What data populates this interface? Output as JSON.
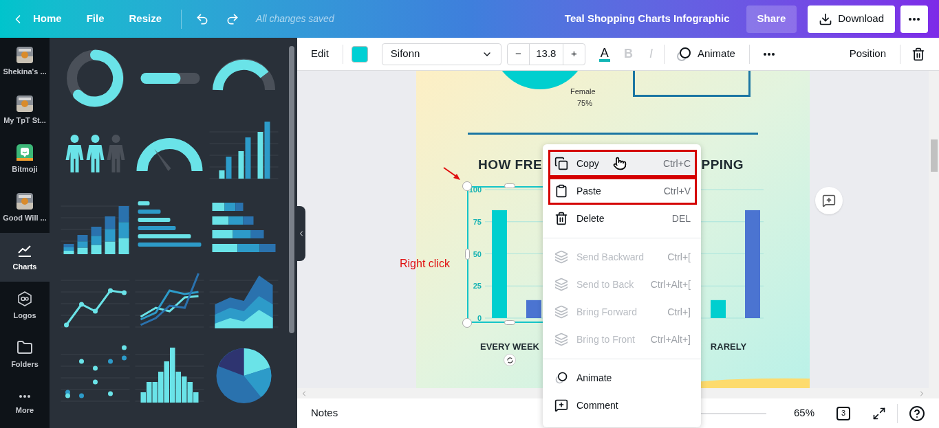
{
  "top_bar": {
    "home": "Home",
    "menu": [
      "File",
      "Resize"
    ],
    "save_status": "All changes saved",
    "title": "Teal Shopping Charts Infographic",
    "share": "Share",
    "download": "Download"
  },
  "rail": [
    {
      "label": "Shekina's ...",
      "kind": "picture",
      "selected": false
    },
    {
      "label": "My TpT St...",
      "kind": "picture",
      "selected": false
    },
    {
      "label": "Bitmoji",
      "kind": "bitmoji",
      "selected": false
    },
    {
      "label": "Good Will ...",
      "kind": "picture",
      "selected": false
    },
    {
      "label": "Charts",
      "kind": "charts",
      "selected": true
    },
    {
      "label": "Logos",
      "kind": "logos",
      "selected": false
    },
    {
      "label": "Folders",
      "kind": "folders",
      "selected": false
    },
    {
      "label": "More",
      "kind": "more",
      "selected": false
    }
  ],
  "panel": {
    "thumbnails": [
      {
        "kind": "donut"
      },
      {
        "kind": "progress"
      },
      {
        "kind": "half_donut"
      },
      {
        "kind": "people"
      },
      {
        "kind": "gauge"
      },
      {
        "kind": "grouped_bars"
      },
      {
        "kind": "stacked_bars"
      },
      {
        "kind": "horizontal_bars"
      },
      {
        "kind": "stacked_horizontal"
      },
      {
        "kind": "line"
      },
      {
        "kind": "multi_line"
      },
      {
        "kind": "area"
      },
      {
        "kind": "dot_plot"
      },
      {
        "kind": "histogram"
      },
      {
        "kind": "pie"
      }
    ]
  },
  "toolbar": {
    "edit": "Edit",
    "color": "#00d0d4",
    "font": "Sifonn",
    "decrease": "−",
    "font_size": "13.8",
    "increase": "+",
    "text_color": "A",
    "bold": {
      "label": "B",
      "disabled": true
    },
    "italic": {
      "label": "I",
      "disabled": true
    },
    "animate": "Animate",
    "position": "Position"
  },
  "page": {
    "female_label": "Female",
    "female_value": "75%",
    "heading_left": "HOW FRE",
    "heading_right": "PPING",
    "chart_data": {
      "type": "bar",
      "categories": [
        "EVERY WEEK",
        "RARELY"
      ],
      "series": [
        {
          "color": "#00cfcf",
          "values": [
            84,
            14
          ]
        },
        {
          "color": "#4b74d1",
          "values": [
            14,
            84
          ]
        }
      ],
      "ylim": [
        0,
        100
      ],
      "yticks": [
        0,
        25,
        50,
        75,
        100
      ],
      "grid": true
    }
  },
  "annotation": {
    "text": "Right click"
  },
  "context_menu": {
    "groups": [
      [
        {
          "label": "Copy",
          "shortcut": "Ctrl+C",
          "disabled": false,
          "selected": true,
          "highlighted": true
        },
        {
          "label": "Paste",
          "shortcut": "Ctrl+V",
          "disabled": false,
          "selected": false,
          "highlighted": true
        },
        {
          "label": "Delete",
          "shortcut": "DEL",
          "disabled": false,
          "selected": false,
          "highlighted": false
        }
      ],
      [
        {
          "label": "Send Backward",
          "shortcut": "Ctrl+[",
          "disabled": true,
          "selected": false,
          "highlighted": false
        },
        {
          "label": "Send to Back",
          "shortcut": "Ctrl+Alt+[",
          "disabled": true,
          "selected": false,
          "highlighted": false
        },
        {
          "label": "Bring Forward",
          "shortcut": "Ctrl+]",
          "disabled": true,
          "selected": false,
          "highlighted": false
        },
        {
          "label": "Bring to Front",
          "shortcut": "Ctrl+Alt+]",
          "disabled": true,
          "selected": false,
          "highlighted": false
        }
      ],
      [
        {
          "label": "Animate",
          "disabled": false,
          "selected": false,
          "highlighted": false
        },
        {
          "label": "Comment",
          "disabled": false,
          "selected": false,
          "highlighted": false
        }
      ]
    ]
  },
  "bottom_bar": {
    "notes": "Notes",
    "zoom": "65%",
    "pages": "3"
  }
}
